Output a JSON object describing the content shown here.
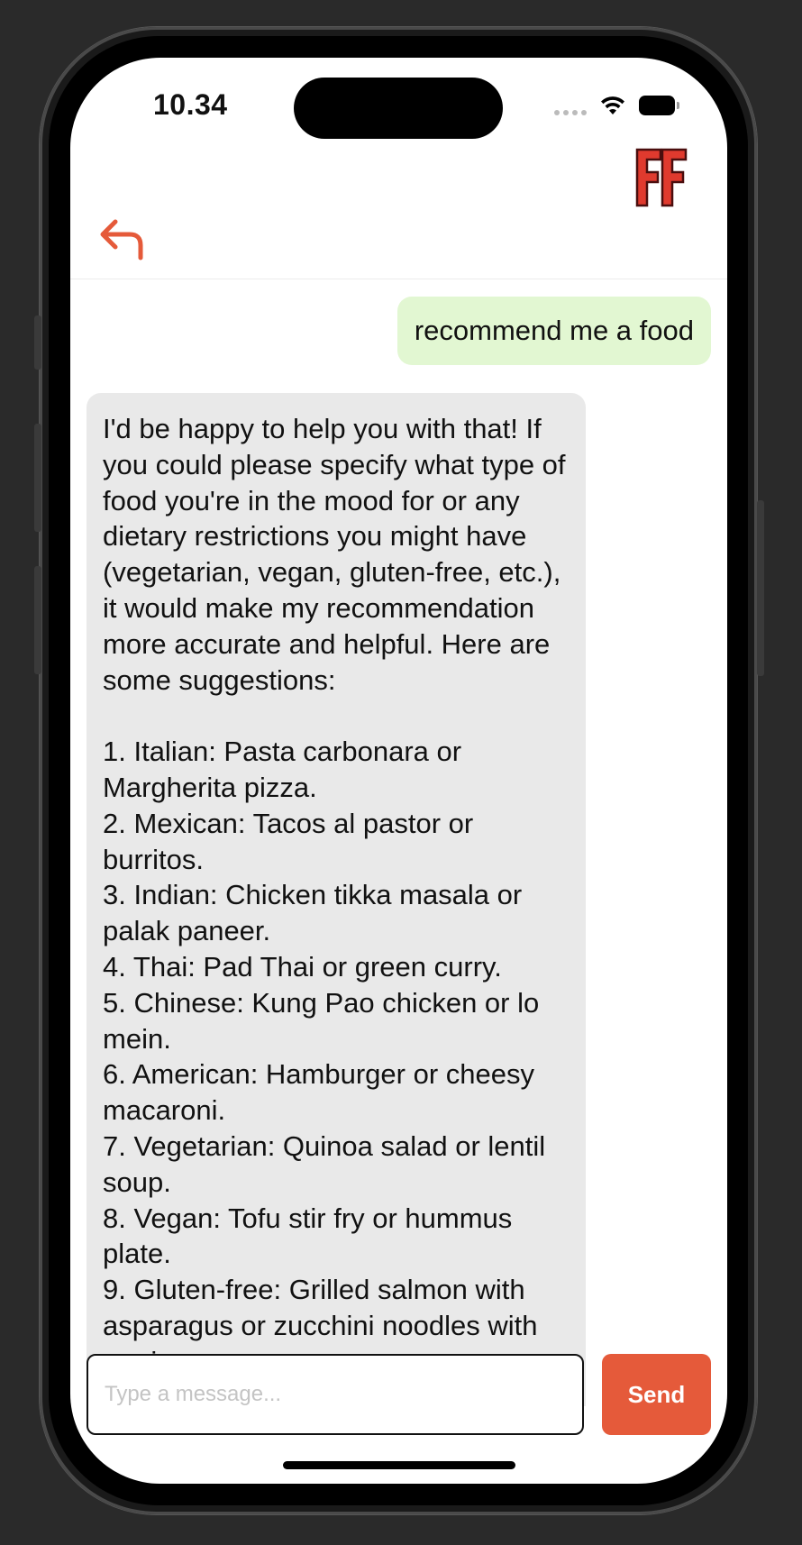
{
  "status_bar": {
    "time": "10.34"
  },
  "header": {
    "back_icon": "back-arrow-icon",
    "logo_icon": "ff-logo-icon"
  },
  "messages": [
    {
      "role": "user",
      "text": "recommend me a food"
    },
    {
      "role": "assistant",
      "text": "I'd be happy to help you with that! If you could please specify what type of food you're in the mood for or any dietary restrictions you might have (vegetarian, vegan, gluten-free, etc.), it would make my recommendation more accurate and helpful. Here are some suggestions:\n\n1. Italian: Pasta carbonara or Margherita pizza.\n2. Mexican: Tacos al pastor or burritos.\n3. Indian: Chicken tikka masala or palak paneer.\n4. Thai: Pad Thai or green curry.\n5. Chinese: Kung Pao chicken or lo mein.\n6. American: Hamburger or cheesy macaroni.\n7. Vegetarian: Quinoa salad or lentil soup.\n8. Vegan: Tofu stir fry or hummus plate.\n9. Gluten-free: Grilled salmon with asparagus or zucchini noodles with marinara sauce."
    }
  ],
  "composer": {
    "placeholder": "Type a message...",
    "value": "",
    "send_label": "Send"
  },
  "colors": {
    "accent": "#e55a3a",
    "user_bubble": "#e2f7d2",
    "bot_bubble": "#e9e9e9",
    "logo_red": "#e03a2e",
    "logo_dark": "#4a0e0e"
  }
}
